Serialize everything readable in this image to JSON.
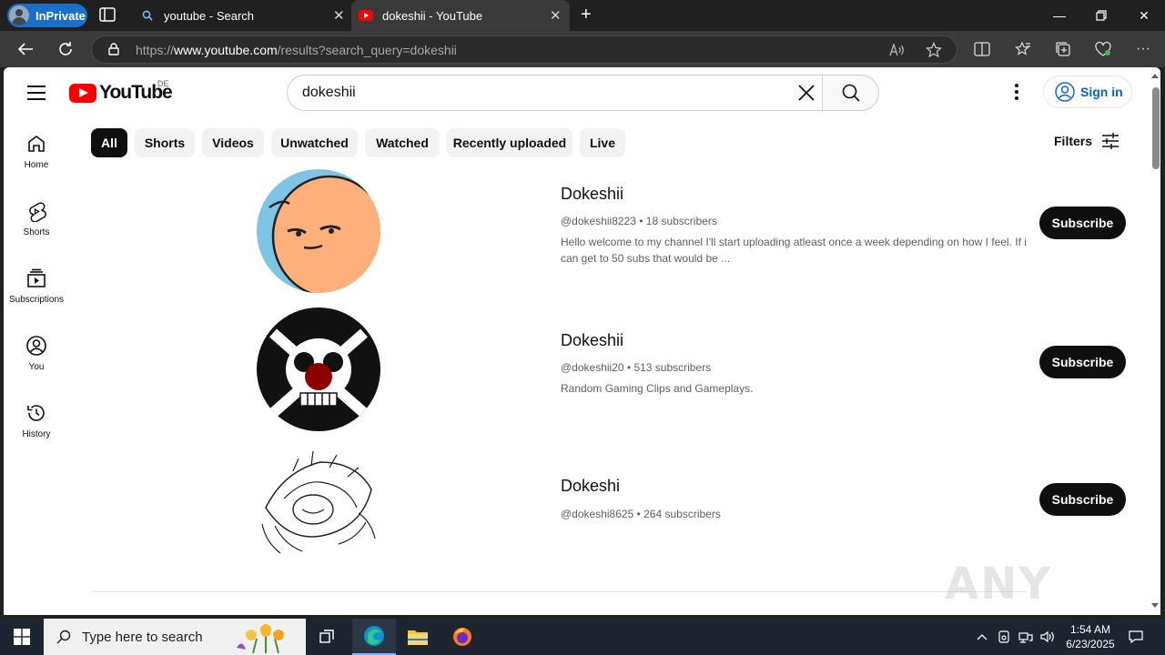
{
  "browser": {
    "inprivate_label": "InPrivate",
    "tabs": [
      {
        "title": "youtube - Search"
      },
      {
        "title": "dokeshii - YouTube"
      }
    ],
    "url_prefix": "https://",
    "url_domain": "www.youtube.com",
    "url_path": "/results?search_query=dokeshii"
  },
  "youtube": {
    "logo_word": "YouTube",
    "country_code": "DE",
    "search_value": "dokeshii",
    "signin_label": "Sign in",
    "sidebar": [
      {
        "label": "Home"
      },
      {
        "label": "Shorts"
      },
      {
        "label": "Subscriptions"
      },
      {
        "label": "You"
      },
      {
        "label": "History"
      }
    ],
    "chips": [
      {
        "label": "All",
        "active": true
      },
      {
        "label": "Shorts"
      },
      {
        "label": "Videos"
      },
      {
        "label": "Unwatched"
      },
      {
        "label": "Watched"
      },
      {
        "label": "Recently uploaded"
      },
      {
        "label": "Live"
      }
    ],
    "filters_label": "Filters",
    "results": [
      {
        "name": "Dokeshii",
        "handle": "@dokeshii8223",
        "subscribers": "18 subscribers",
        "description": "Hello welcome to my channel I'll start uploading atleast once a week depending on how I feel. If i can get to 50 subs that would be ...",
        "button": "Subscribe"
      },
      {
        "name": "Dokeshii",
        "handle": "@dokeshii20",
        "subscribers": "513 subscribers",
        "description": "Random Gaming Clips and Gameplays.",
        "button": "Subscribe"
      },
      {
        "name": "Dokeshi",
        "handle": "@dokeshi8625",
        "subscribers": "264 subscribers",
        "description": "",
        "button": "Subscribe"
      }
    ]
  },
  "watermark": "ANY RUN",
  "taskbar": {
    "search_placeholder": "Type here to search",
    "time": "1:54 AM",
    "date": "6/23/2025"
  },
  "colors": {
    "yt_red": "#ff0000",
    "link_blue": "#065fd4",
    "subscribe_bg": "#0f0f0f",
    "inprivate_blue": "#1a6fc9"
  }
}
